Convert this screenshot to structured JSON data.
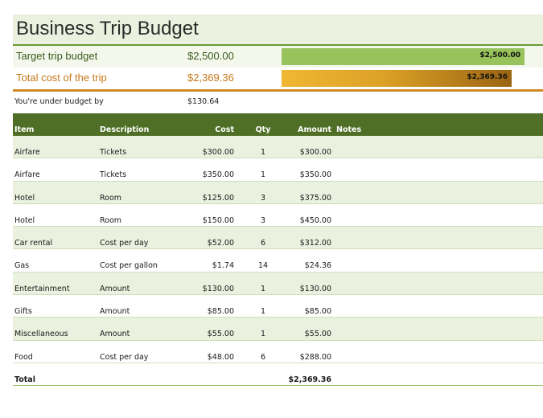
{
  "title": "Business Trip Budget",
  "summary": {
    "target_label": "Target trip budget",
    "target_value": "$2,500.00",
    "target_bar_label": "$2,500.00",
    "target_fraction": 1.0,
    "total_label": "Total cost of the trip",
    "total_value": "$2,369.36",
    "total_bar_label": "$2,369.36",
    "total_fraction": 0.9477,
    "under_label": "You're under budget by",
    "under_value": "$130.64"
  },
  "table": {
    "headers": {
      "item": "Item",
      "description": "Description",
      "cost": "Cost",
      "qty": "Qty",
      "amount": "Amount",
      "notes": "Notes"
    },
    "rows": [
      {
        "item": "Airfare",
        "description": "Tickets",
        "cost": "$300.00",
        "qty": "1",
        "amount": "$300.00"
      },
      {
        "item": "Airfare",
        "description": "Tickets",
        "cost": "$350.00",
        "qty": "1",
        "amount": "$350.00"
      },
      {
        "item": "Hotel",
        "description": "Room",
        "cost": "$125.00",
        "qty": "3",
        "amount": "$375.00"
      },
      {
        "item": "Hotel",
        "description": "Room",
        "cost": "$150.00",
        "qty": "3",
        "amount": "$450.00"
      },
      {
        "item": "Car rental",
        "description": "Cost per day",
        "cost": "$52.00",
        "qty": "6",
        "amount": "$312.00"
      },
      {
        "item": "Gas",
        "description": "Cost per gallon",
        "cost": "$1.74",
        "qty": "14",
        "amount": "$24.36"
      },
      {
        "item": "Entertainment",
        "description": "Amount",
        "cost": "$130.00",
        "qty": "1",
        "amount": "$130.00"
      },
      {
        "item": "Gifts",
        "description": "Amount",
        "cost": "$85.00",
        "qty": "1",
        "amount": "$85.00"
      },
      {
        "item": "Miscellaneous",
        "description": "Amount",
        "cost": "$55.00",
        "qty": "1",
        "amount": "$55.00"
      },
      {
        "item": "Food",
        "description": "Cost per day",
        "cost": "$48.00",
        "qty": "6",
        "amount": "$288.00"
      }
    ],
    "total_label": "Total",
    "total_amount": "$2,369.36"
  },
  "colors": {
    "header_bg": "#4f6f27",
    "band_bg": "#eaf1de",
    "target_bar": "#97c25c",
    "total_bar_start": "#f0b733",
    "total_bar_end": "#9a6412",
    "total_text": "#c6781a"
  }
}
